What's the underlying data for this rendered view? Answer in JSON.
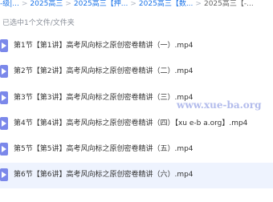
{
  "breadcrumb": {
    "items": [
      "-级|...",
      "2025高三",
      "2025高三【押...",
      "2025高三【数...",
      "2025高三【-..."
    ],
    "separator": ">"
  },
  "selection_info": "已选中1个文件/文件夹",
  "files": [
    {
      "name": "第1节【第1讲】高考风向标之原创密卷精讲（一）.mp4",
      "icon": "video-file-icon"
    },
    {
      "name": "第2节【第2讲】高考风向标之原创密卷精讲（二）.mp4",
      "icon": "video-file-icon"
    },
    {
      "name": "第3节【第3讲】高考风向标之原创密卷精讲（三）.mp4",
      "icon": "video-file-icon"
    },
    {
      "name": "第4节【第4讲】高考风向标之原创密卷精讲（四）【xu e-b a.org】.mp4",
      "icon": "video-file-icon"
    },
    {
      "name": "第5节【第5讲】高考风向标之原创密卷精讲（五）.mp4",
      "icon": "video-file-icon"
    },
    {
      "name": "第6节【第6讲】高考风向标之原创密卷精讲（六）.mp4",
      "icon": "video-file-icon"
    }
  ],
  "watermark": "www.xue-ba.org",
  "colors": {
    "accent": "#1a73e8",
    "icon": "#7b88ea",
    "selected_row": "#eef3fe",
    "muted_text": "#8a8f99"
  }
}
